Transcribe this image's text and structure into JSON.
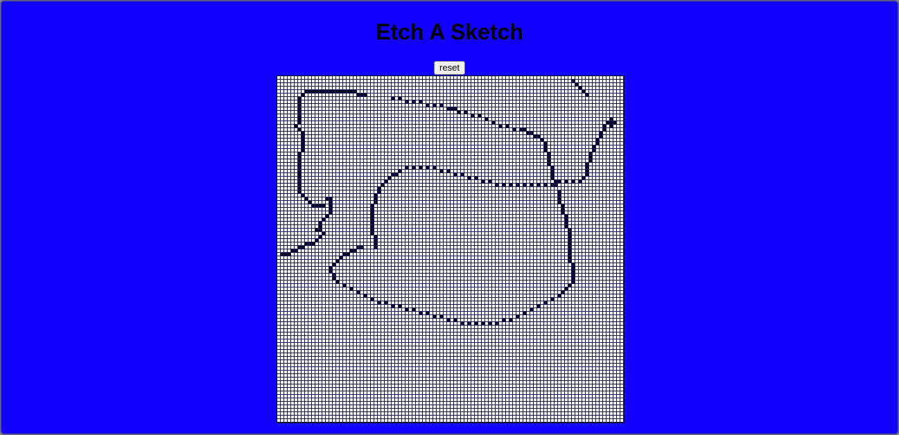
{
  "page": {
    "title": "Etch A Sketch",
    "background_color": "#1200ff"
  },
  "controls": {
    "reset_label": "reset"
  },
  "sketch_grid": {
    "columns": 100,
    "rows": 100,
    "cell_color": "#ffffff",
    "drawn_color": "#05052a",
    "drawn_cells": [
      [
        8,
        4
      ],
      [
        9,
        4
      ],
      [
        10,
        4
      ],
      [
        11,
        4
      ],
      [
        12,
        4
      ],
      [
        13,
        4
      ],
      [
        14,
        4
      ],
      [
        15,
        4
      ],
      [
        16,
        4
      ],
      [
        17,
        4
      ],
      [
        18,
        4
      ],
      [
        19,
        4
      ],
      [
        20,
        4
      ],
      [
        21,
        4
      ],
      [
        22,
        4
      ],
      [
        23,
        5
      ],
      [
        24,
        5
      ],
      [
        25,
        5
      ],
      [
        7,
        5
      ],
      [
        6,
        6
      ],
      [
        6,
        7
      ],
      [
        6,
        8
      ],
      [
        6,
        9
      ],
      [
        6,
        10
      ],
      [
        6,
        11
      ],
      [
        6,
        12
      ],
      [
        6,
        13
      ],
      [
        5,
        14
      ],
      [
        6,
        15
      ],
      [
        7,
        16
      ],
      [
        7,
        17
      ],
      [
        7,
        18
      ],
      [
        7,
        19
      ],
      [
        7,
        20
      ],
      [
        7,
        21
      ],
      [
        6,
        22
      ],
      [
        6,
        23
      ],
      [
        6,
        24
      ],
      [
        6,
        25
      ],
      [
        6,
        26
      ],
      [
        6,
        27
      ],
      [
        6,
        28
      ],
      [
        6,
        29
      ],
      [
        6,
        30
      ],
      [
        6,
        31
      ],
      [
        6,
        32
      ],
      [
        6,
        33
      ],
      [
        7,
        34
      ],
      [
        8,
        35
      ],
      [
        9,
        36
      ],
      [
        10,
        37
      ],
      [
        11,
        37
      ],
      [
        12,
        37
      ],
      [
        13,
        37
      ],
      [
        14,
        35
      ],
      [
        15,
        35
      ],
      [
        15,
        36
      ],
      [
        15,
        37
      ],
      [
        15,
        38
      ],
      [
        15,
        39
      ],
      [
        14,
        40
      ],
      [
        13,
        41
      ],
      [
        12,
        42
      ],
      [
        12,
        43
      ],
      [
        11,
        44
      ],
      [
        12,
        44
      ],
      [
        13,
        45
      ],
      [
        12,
        46
      ],
      [
        11,
        47
      ],
      [
        10,
        48
      ],
      [
        9,
        48
      ],
      [
        8,
        48
      ],
      [
        7,
        49
      ],
      [
        6,
        49
      ],
      [
        5,
        50
      ],
      [
        4,
        50
      ],
      [
        3,
        51
      ],
      [
        2,
        51
      ],
      [
        1,
        51
      ],
      [
        33,
        6
      ],
      [
        35,
        6
      ],
      [
        37,
        7
      ],
      [
        39,
        7
      ],
      [
        41,
        7
      ],
      [
        43,
        8
      ],
      [
        45,
        8
      ],
      [
        47,
        8
      ],
      [
        49,
        9
      ],
      [
        50,
        9
      ],
      [
        51,
        9
      ],
      [
        52,
        10
      ],
      [
        54,
        10
      ],
      [
        56,
        11
      ],
      [
        58,
        11
      ],
      [
        60,
        12
      ],
      [
        62,
        13
      ],
      [
        64,
        14
      ],
      [
        66,
        14
      ],
      [
        68,
        15
      ],
      [
        70,
        15
      ],
      [
        71,
        15
      ],
      [
        72,
        16
      ],
      [
        73,
        16
      ],
      [
        74,
        17
      ],
      [
        75,
        17
      ],
      [
        76,
        18
      ],
      [
        77,
        19
      ],
      [
        77,
        20
      ],
      [
        77,
        21
      ],
      [
        78,
        22
      ],
      [
        78,
        23
      ],
      [
        78,
        24
      ],
      [
        78,
        25
      ],
      [
        79,
        26
      ],
      [
        79,
        27
      ],
      [
        79,
        28
      ],
      [
        79,
        29
      ],
      [
        80,
        30
      ],
      [
        80,
        31
      ],
      [
        85,
        1
      ],
      [
        86,
        2
      ],
      [
        87,
        3
      ],
      [
        88,
        4
      ],
      [
        89,
        5
      ],
      [
        96,
        12
      ],
      [
        95,
        13
      ],
      [
        94,
        14
      ],
      [
        94,
        15
      ],
      [
        93,
        16
      ],
      [
        93,
        17
      ],
      [
        92,
        18
      ],
      [
        92,
        19
      ],
      [
        91,
        20
      ],
      [
        91,
        21
      ],
      [
        90,
        22
      ],
      [
        90,
        23
      ],
      [
        90,
        24
      ],
      [
        89,
        25
      ],
      [
        89,
        26
      ],
      [
        89,
        27
      ],
      [
        89,
        28
      ],
      [
        88,
        29
      ],
      [
        87,
        30
      ],
      [
        85,
        30
      ],
      [
        83,
        30
      ],
      [
        81,
        30
      ],
      [
        79,
        31
      ],
      [
        77,
        31
      ],
      [
        75,
        31
      ],
      [
        73,
        31
      ],
      [
        71,
        31
      ],
      [
        69,
        31
      ],
      [
        67,
        31
      ],
      [
        65,
        31
      ],
      [
        63,
        31
      ],
      [
        61,
        30
      ],
      [
        59,
        30
      ],
      [
        57,
        29
      ],
      [
        55,
        29
      ],
      [
        53,
        28
      ],
      [
        51,
        28
      ],
      [
        49,
        27
      ],
      [
        47,
        27
      ],
      [
        45,
        26
      ],
      [
        43,
        26
      ],
      [
        41,
        26
      ],
      [
        39,
        26
      ],
      [
        37,
        26
      ],
      [
        35,
        27
      ],
      [
        34,
        28
      ],
      [
        33,
        28
      ],
      [
        32,
        29
      ],
      [
        31,
        30
      ],
      [
        30,
        31
      ],
      [
        29,
        32
      ],
      [
        29,
        33
      ],
      [
        28,
        34
      ],
      [
        28,
        35
      ],
      [
        28,
        36
      ],
      [
        27,
        37
      ],
      [
        27,
        38
      ],
      [
        27,
        39
      ],
      [
        27,
        40
      ],
      [
        27,
        41
      ],
      [
        27,
        42
      ],
      [
        27,
        43
      ],
      [
        27,
        44
      ],
      [
        27,
        45
      ],
      [
        28,
        46
      ],
      [
        28,
        47
      ],
      [
        28,
        48
      ],
      [
        28,
        49
      ],
      [
        96,
        13
      ],
      [
        97,
        13
      ],
      [
        96,
        14
      ],
      [
        81,
        33
      ],
      [
        81,
        34
      ],
      [
        81,
        35
      ],
      [
        81,
        36
      ],
      [
        82,
        37
      ],
      [
        82,
        38
      ],
      [
        82,
        39
      ],
      [
        83,
        40
      ],
      [
        83,
        41
      ],
      [
        83,
        42
      ],
      [
        83,
        43
      ],
      [
        84,
        44
      ],
      [
        84,
        45
      ],
      [
        84,
        46
      ],
      [
        84,
        47
      ],
      [
        84,
        48
      ],
      [
        84,
        49
      ],
      [
        84,
        50
      ],
      [
        84,
        51
      ],
      [
        84,
        52
      ],
      [
        84,
        53
      ],
      [
        85,
        54
      ],
      [
        85,
        55
      ],
      [
        85,
        56
      ],
      [
        85,
        57
      ],
      [
        85,
        58
      ],
      [
        85,
        59
      ],
      [
        84,
        60
      ],
      [
        83,
        61
      ],
      [
        82,
        62
      ],
      [
        81,
        63
      ],
      [
        79,
        64
      ],
      [
        77,
        65
      ],
      [
        75,
        66
      ],
      [
        73,
        67
      ],
      [
        71,
        68
      ],
      [
        69,
        69
      ],
      [
        67,
        70
      ],
      [
        65,
        70
      ],
      [
        63,
        71
      ],
      [
        61,
        71
      ],
      [
        59,
        71
      ],
      [
        57,
        71
      ],
      [
        55,
        71
      ],
      [
        53,
        71
      ],
      [
        51,
        70
      ],
      [
        49,
        70
      ],
      [
        47,
        69
      ],
      [
        45,
        69
      ],
      [
        43,
        68
      ],
      [
        41,
        68
      ],
      [
        39,
        67
      ],
      [
        37,
        67
      ],
      [
        35,
        66
      ],
      [
        33,
        66
      ],
      [
        31,
        65
      ],
      [
        29,
        65
      ],
      [
        27,
        64
      ],
      [
        25,
        63
      ],
      [
        23,
        62
      ],
      [
        21,
        61
      ],
      [
        19,
        60
      ],
      [
        17,
        59
      ],
      [
        16,
        58
      ],
      [
        16,
        57
      ],
      [
        15,
        56
      ],
      [
        15,
        55
      ],
      [
        16,
        54
      ],
      [
        17,
        53
      ],
      [
        18,
        52
      ],
      [
        19,
        51
      ],
      [
        20,
        51
      ],
      [
        21,
        50
      ],
      [
        22,
        50
      ],
      [
        23,
        49
      ],
      [
        24,
        49
      ]
    ]
  }
}
